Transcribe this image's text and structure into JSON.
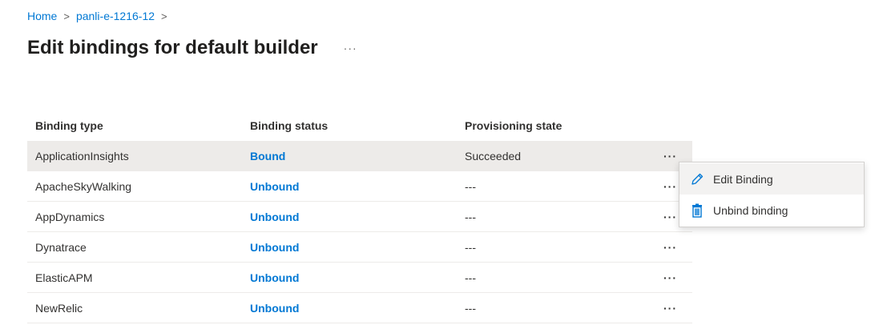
{
  "breadcrumb": {
    "home": "Home",
    "sep": ">",
    "resource": "panli-e-1216-12"
  },
  "page": {
    "title": "Edit bindings for default builder",
    "more": "···"
  },
  "table": {
    "headers": {
      "type": "Binding type",
      "status": "Binding status",
      "state": "Provisioning state"
    },
    "rows": [
      {
        "type": "ApplicationInsights",
        "status": "Bound",
        "state": "Succeeded",
        "more": "···"
      },
      {
        "type": "ApacheSkyWalking",
        "status": "Unbound",
        "state": "---",
        "more": "···"
      },
      {
        "type": "AppDynamics",
        "status": "Unbound",
        "state": "---",
        "more": "···"
      },
      {
        "type": "Dynatrace",
        "status": "Unbound",
        "state": "---",
        "more": "···"
      },
      {
        "type": "ElasticAPM",
        "status": "Unbound",
        "state": "---",
        "more": "···"
      },
      {
        "type": "NewRelic",
        "status": "Unbound",
        "state": "---",
        "more": "···"
      }
    ]
  },
  "context_menu": {
    "edit": {
      "label": "Edit Binding",
      "icon": "pencil-icon"
    },
    "unbind": {
      "label": "Unbind binding",
      "icon": "trash-icon"
    }
  },
  "colors": {
    "accent": "#0078d4",
    "selected_row": "#edebe9"
  }
}
